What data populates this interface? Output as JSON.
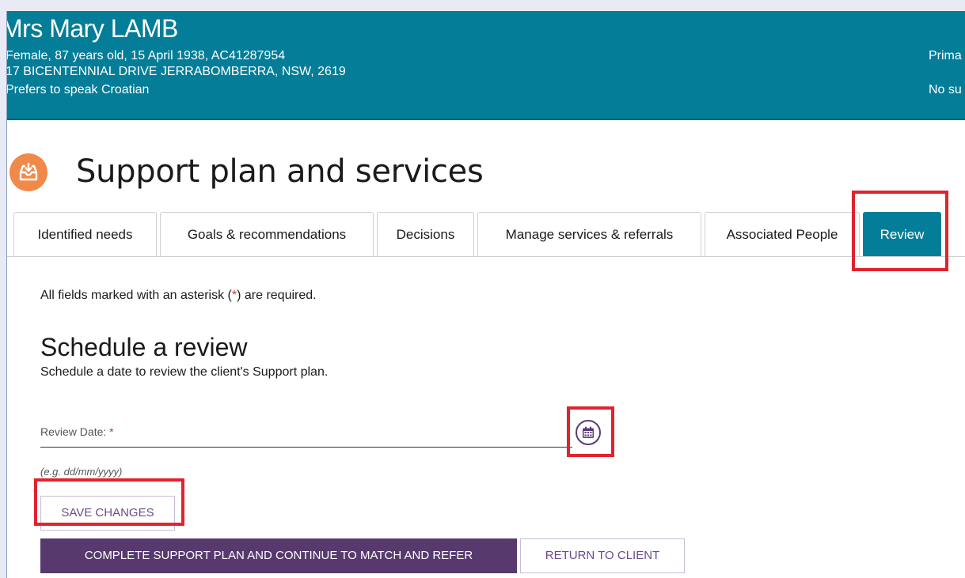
{
  "client": {
    "name": "Mrs Mary LAMB",
    "details": "Female, 87 years old, 15 April 1938, AC41287954",
    "address": "17 BICENTENNIAL DRIVE JERRABOMBERRA, NSW, 2619",
    "language": "Prefers to speak Croatian",
    "right_line_1": "Prima",
    "right_line_2": "No su"
  },
  "page": {
    "title": "Support plan and services",
    "icon": "inbox-download-icon"
  },
  "tabs": [
    {
      "label": "Identified needs",
      "active": false
    },
    {
      "label": "Goals & recommendations",
      "active": false
    },
    {
      "label": "Decisions",
      "active": false
    },
    {
      "label": "Manage services & referrals",
      "active": false
    },
    {
      "label": "Associated People",
      "active": false
    },
    {
      "label": "Review",
      "active": true
    }
  ],
  "form": {
    "required_note_before": "All fields marked with an asterisk (",
    "required_note_star": "*",
    "required_note_after": ") are required.",
    "section_heading": "Schedule a review",
    "section_description": "Schedule a date to review the client's Support plan.",
    "review_date_label": "Review Date:",
    "required_marker": "*",
    "review_date_value": "",
    "review_date_hint": "(e.g. dd/mm/yyyy)",
    "calendar_icon": "calendar-icon"
  },
  "buttons": {
    "save": "SAVE CHANGES",
    "complete": "COMPLETE SUPPORT PLAN AND CONTINUE TO MATCH AND REFER",
    "return": "RETURN TO CLIENT"
  },
  "colors": {
    "banner": "#047d98",
    "accent_purple": "#57396e",
    "highlight_red": "#e1232e",
    "page_icon": "#f08a4b"
  }
}
